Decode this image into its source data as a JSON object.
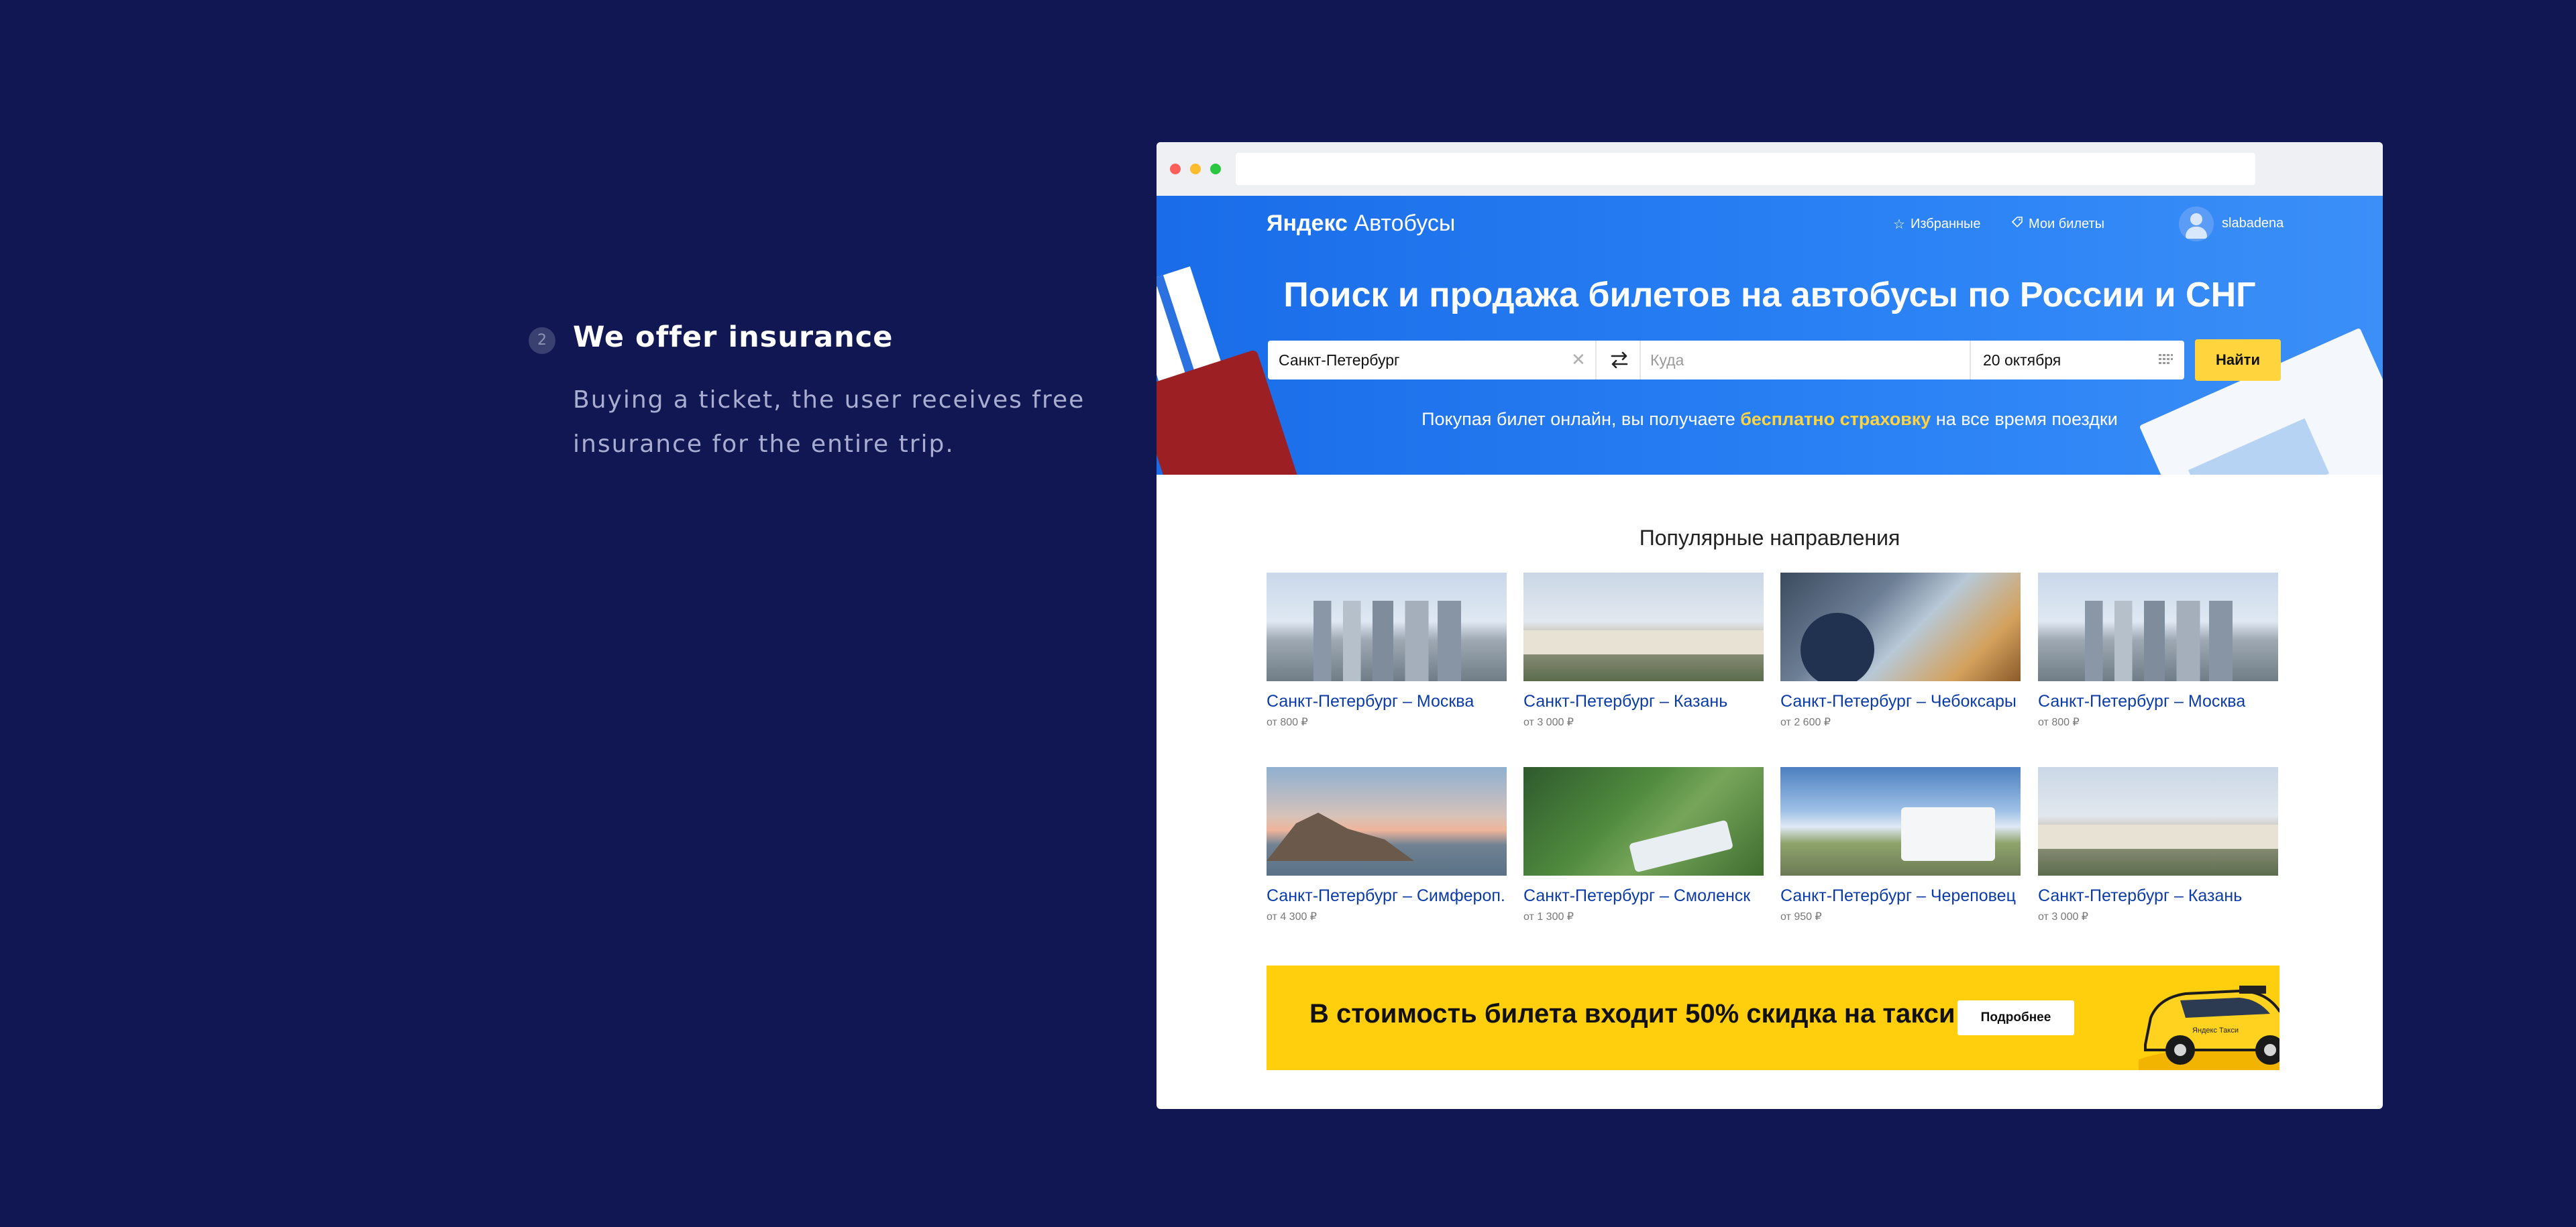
{
  "caption": {
    "step": "2",
    "title": "We offer insurance",
    "text": "Buying a ticket, the user receives free insurance for the entire trip."
  },
  "header": {
    "logo_brand": "Яндекс",
    "logo_product": "Автобусы",
    "favorites_label": "Избранные",
    "my_tickets_label": "Мои билеты",
    "username": "slabadena"
  },
  "hero": {
    "title": "Поиск и продажа билетов на автобусы по России и СНГ",
    "from_value": "Санкт-Петербург",
    "to_placeholder": "Куда",
    "date_value": "20 октября",
    "find_label": "Найти",
    "promo_before": "Покупая билет онлайн, вы получаете ",
    "promo_highlight": "бесплатно страховку",
    "promo_after": " на все время поездки"
  },
  "popular": {
    "title": "Популярные направления",
    "cards": [
      {
        "route": "Санкт-Петербург – Москва",
        "price": "от 800 ₽"
      },
      {
        "route": "Санкт-Петербург – Казань",
        "price": "от 3 000 ₽"
      },
      {
        "route": "Санкт-Петербург – Чебоксары",
        "price": "от 2 600 ₽"
      },
      {
        "route": "Санкт-Петербург – Москва",
        "price": "от 800 ₽"
      },
      {
        "route": "Санкт-Петербург – Симфероп.",
        "price": "от 4 300 ₽"
      },
      {
        "route": "Санкт-Петербург – Смоленск",
        "price": "от 1 300 ₽"
      },
      {
        "route": "Санкт-Петербург – Череповец",
        "price": "от 950 ₽"
      },
      {
        "route": "Санкт-Петербург – Казань",
        "price": "от 3 000 ₽"
      }
    ]
  },
  "taxi_banner": {
    "text": "В стоимость билета входит 50% скидка на такси",
    "button_label": "Подробнее",
    "car_label": "Яндекс Такси"
  },
  "colors": {
    "background": "#101753",
    "hero_blue": "#2a7af3",
    "accent_yellow": "#ffd43c",
    "link_blue": "#0c3ca8",
    "banner_yellow": "#ffce0c"
  }
}
